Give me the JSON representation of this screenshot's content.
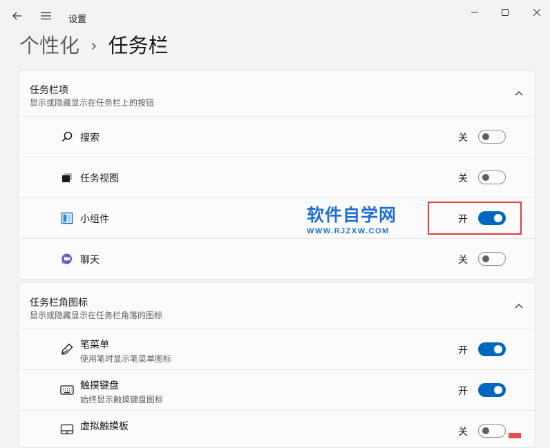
{
  "window": {
    "title": "设置"
  },
  "breadcrumb": {
    "parent": "个性化",
    "separator": "›",
    "current": "任务栏"
  },
  "sections": [
    {
      "title": "任务栏项",
      "subtitle": "显示或隐藏显示在任务栏上的按钮",
      "expanded": true,
      "items": [
        {
          "label": "搜索",
          "icon": "search-icon",
          "state": "关",
          "on": false
        },
        {
          "label": "任务视图",
          "icon": "task-view-icon",
          "state": "关",
          "on": false
        },
        {
          "label": "小组件",
          "icon": "widgets-icon",
          "state": "开",
          "on": true
        },
        {
          "label": "聊天",
          "icon": "chat-icon",
          "state": "关",
          "on": false
        }
      ]
    },
    {
      "title": "任务栏角图标",
      "subtitle": "显示或隐藏显示在任务栏角落的图标",
      "expanded": true,
      "items": [
        {
          "label": "笔菜单",
          "sub": "使用笔时显示笔菜单图标",
          "icon": "pen-icon",
          "state": "开",
          "on": true
        },
        {
          "label": "触摸键盘",
          "sub": "始终显示触摸键盘图标",
          "icon": "keyboard-icon",
          "state": "开",
          "on": true
        },
        {
          "label": "虚拟触摸板",
          "icon": "touchpad-icon",
          "state": "关",
          "on": false
        }
      ]
    }
  ],
  "watermark": {
    "main": "软件自学网",
    "url": "WWW.RJZXW.COM"
  },
  "colors": {
    "accent": "#0067c0",
    "highlight_border": "#e03c3c",
    "watermark": "#1f6fd0"
  }
}
